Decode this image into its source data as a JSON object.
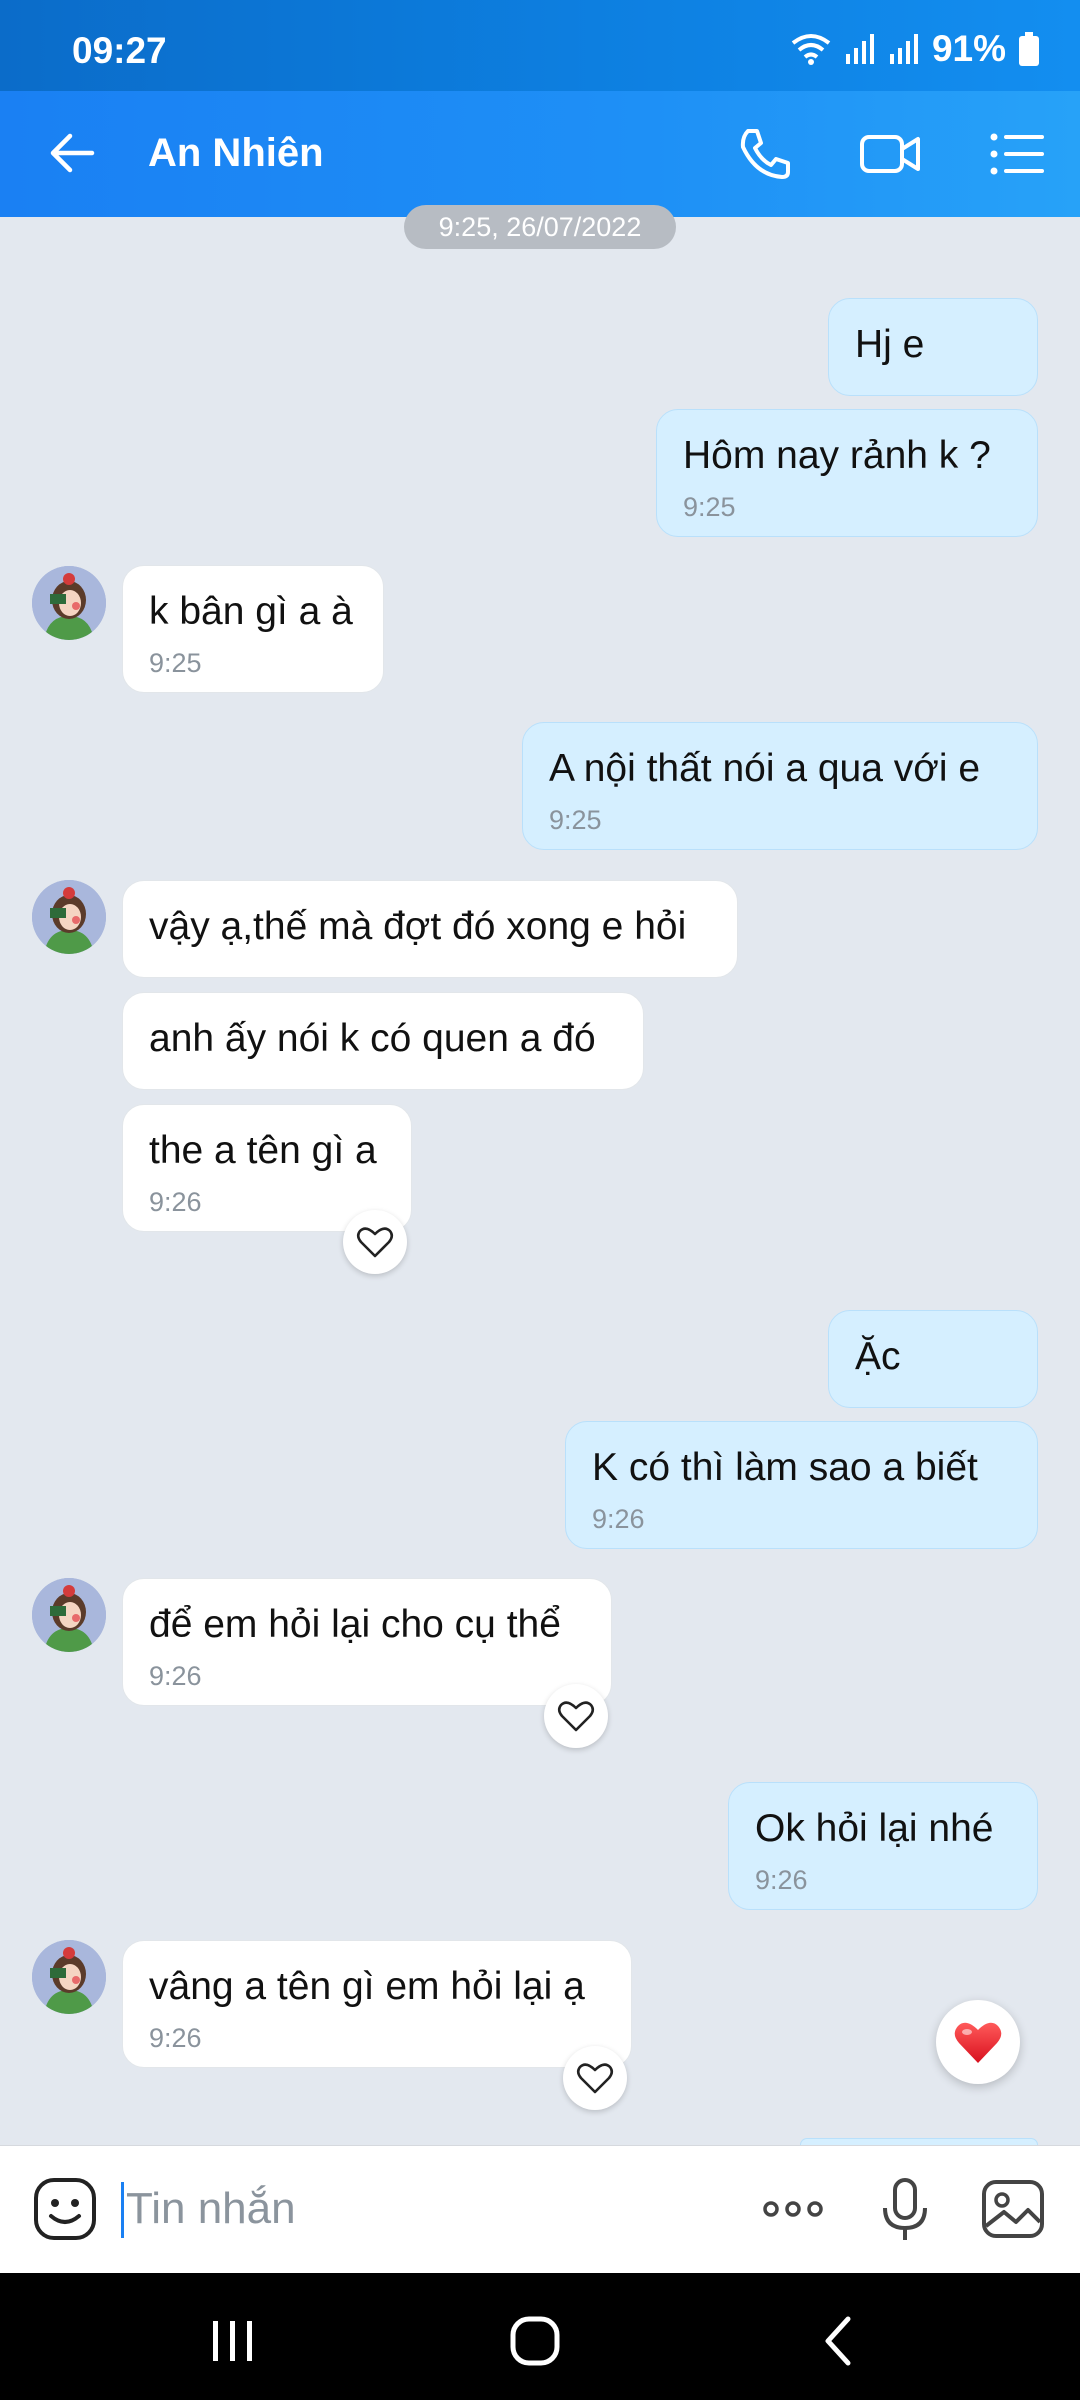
{
  "status": {
    "time": "09:27",
    "battery": "91%"
  },
  "header": {
    "title": "An Nhiên"
  },
  "date_separator": "9:25, 26/07/2022",
  "messages": [
    {
      "dir": "out",
      "text": "Hj e",
      "time": ""
    },
    {
      "dir": "out",
      "text": "Hôm nay rảnh k ?",
      "time": "9:25"
    },
    {
      "dir": "in",
      "text": "k bân gì a à",
      "time": "9:25"
    },
    {
      "dir": "out",
      "text": "A nội thất nói a qua với e",
      "time": "9:25"
    },
    {
      "dir": "in",
      "text": "vậy ạ,thế mà đợt đó xong e hỏi",
      "time": ""
    },
    {
      "dir": "in",
      "text": "anh ấy nói k có quen a đó",
      "time": ""
    },
    {
      "dir": "in",
      "text": "the a tên gì a",
      "time": "9:26"
    },
    {
      "dir": "out",
      "text": "Ặc",
      "time": ""
    },
    {
      "dir": "out",
      "text": "K có thì làm sao a biết",
      "time": "9:26"
    },
    {
      "dir": "in",
      "text": "để em hỏi lại cho cụ thể",
      "time": "9:26"
    },
    {
      "dir": "out",
      "text": "Ok hỏi lại nhé",
      "time": "9:26"
    },
    {
      "dir": "in",
      "text": "vâng a tên gì em hỏi lại ạ",
      "time": "9:26"
    }
  ],
  "input": {
    "placeholder": "Tin nhắn"
  },
  "colors": {
    "header": "#1e90f6",
    "out_bubble": "#d5efff",
    "in_bubble": "#ffffff",
    "background": "#e3e8ef",
    "heart": "#e8212b"
  }
}
